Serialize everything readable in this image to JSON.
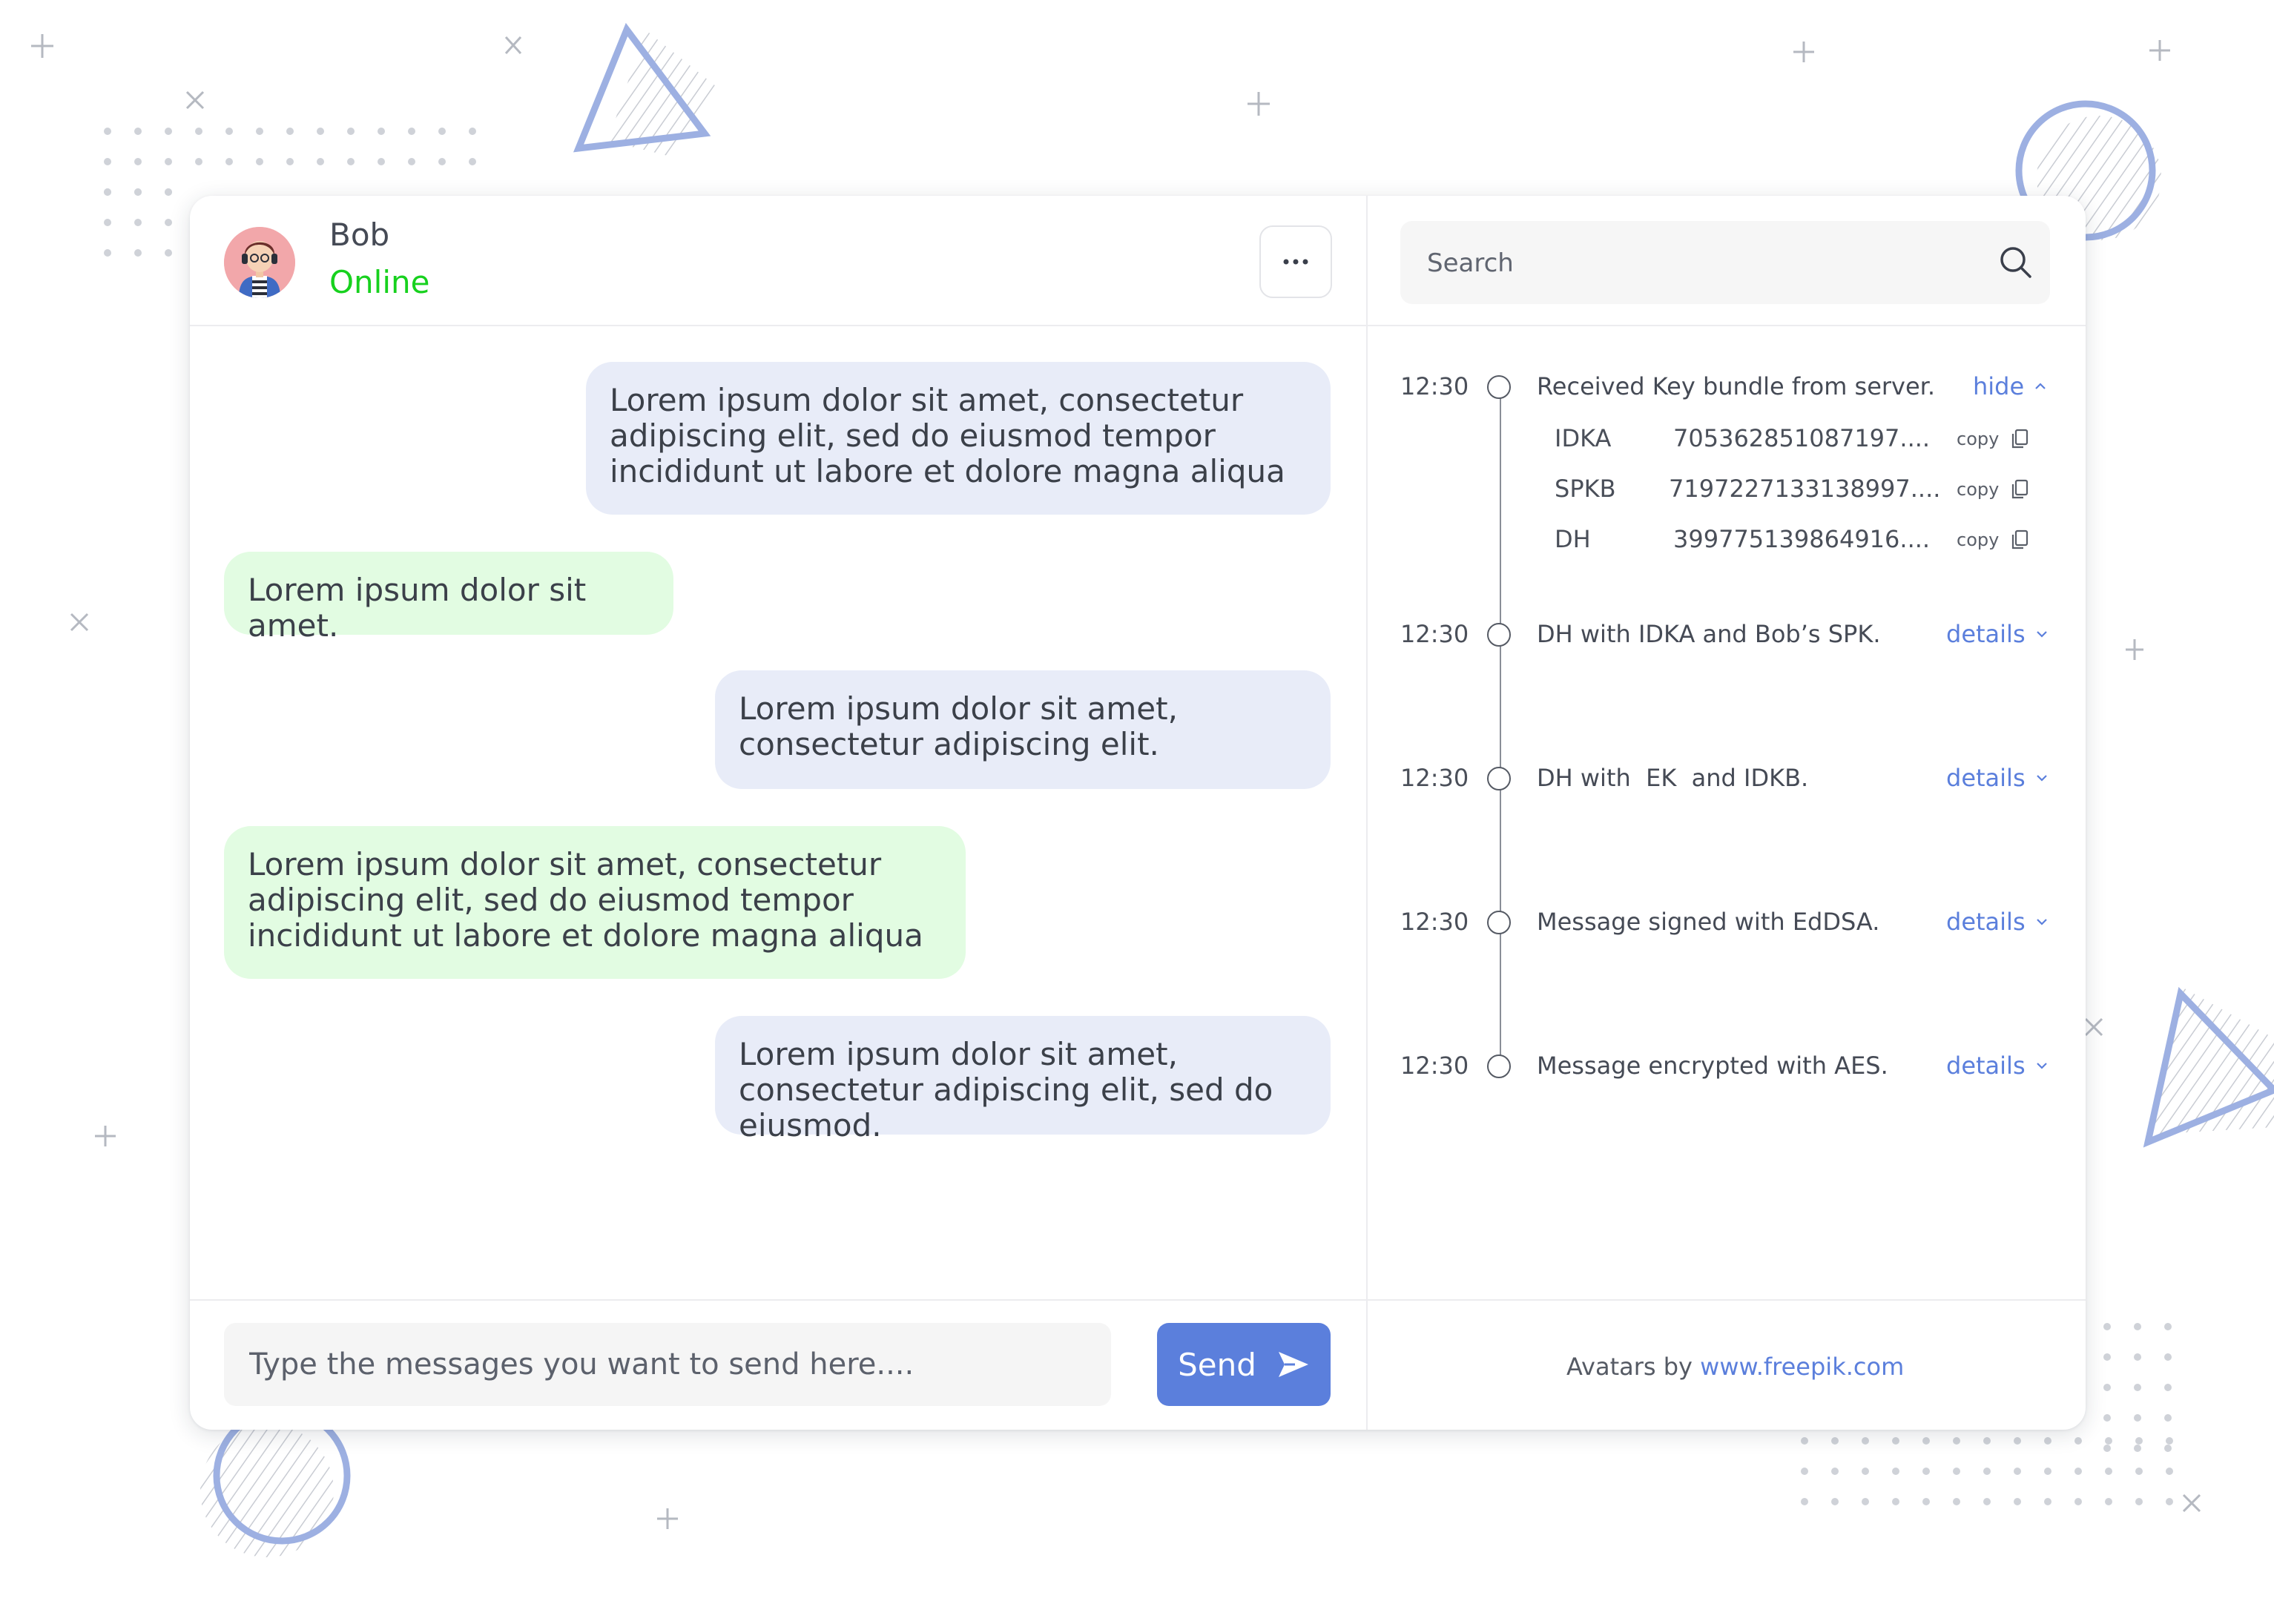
{
  "contact": {
    "name": "Bob",
    "status": "Online"
  },
  "search": {
    "placeholder": "Search"
  },
  "messages": [
    {
      "direction": "out",
      "text": "Lorem ipsum dolor sit amet, consectetur adipiscing elit, sed do eiusmod tempor incididunt ut labore et dolore magna aliqua"
    },
    {
      "direction": "in",
      "text": "Lorem ipsum dolor sit amet."
    },
    {
      "direction": "out",
      "text": "Lorem ipsum dolor sit amet, consectetur adipiscing elit."
    },
    {
      "direction": "in",
      "text": "Lorem ipsum dolor sit amet, consectetur adipiscing elit, sed do eiusmod tempor incididunt ut labore et dolore magna aliqua"
    },
    {
      "direction": "out",
      "text": "Lorem ipsum dolor sit amet, consectetur adipiscing elit, sed do eiusmod."
    }
  ],
  "compose": {
    "placeholder": "Type the messages you want to send here....",
    "send_label": "Send"
  },
  "timeline": [
    {
      "time": "12:30",
      "text": "Received Key bundle from server.",
      "action": "hide",
      "expanded": true,
      "fields": [
        {
          "key": "IDKA",
          "value": "705362851087197....",
          "copy": "copy"
        },
        {
          "key": "SPKB",
          "value": "7197227133138997....",
          "copy": "copy"
        },
        {
          "key": "DH",
          "value": "399775139864916....",
          "copy": "copy"
        }
      ]
    },
    {
      "time": "12:30",
      "text": "DH with IDKA and Bob’s SPK.",
      "action": "details",
      "expanded": false
    },
    {
      "time": "12:30",
      "text": "DH with  EK  and IDKB.",
      "action": "details",
      "expanded": false
    },
    {
      "time": "12:30",
      "text": "Message signed with EdDSA.",
      "action": "details",
      "expanded": false
    },
    {
      "time": "12:30",
      "text": "Message encrypted with AES.",
      "action": "details",
      "expanded": false
    }
  ],
  "credit": {
    "prefix": "Avatars by",
    "link": "www.freepik.com"
  },
  "colors": {
    "accent": "#5b7fdc",
    "online": "#17d11e",
    "outgoing_bubble": "#e8ecf8",
    "incoming_bubble": "#e2fce2"
  }
}
